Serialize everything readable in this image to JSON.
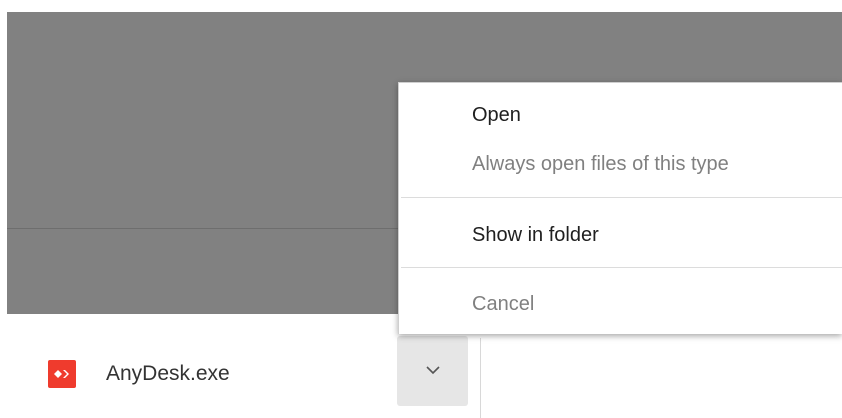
{
  "context_menu": {
    "items": [
      {
        "label": "Open",
        "enabled": true
      },
      {
        "label": "Always open files of this type",
        "enabled": false
      },
      {
        "label": "Show in folder",
        "enabled": true
      },
      {
        "label": "Cancel",
        "enabled": false
      }
    ]
  },
  "download_shelf": {
    "file_name": "AnyDesk.exe",
    "file_icon": "anydesk-icon",
    "menu_button_icon": "chevron-down-icon"
  },
  "colors": {
    "dim_overlay": "#818181",
    "file_icon_red": "#ef3b2d",
    "menu_background": "#ffffff",
    "disabled_text": "#808080"
  }
}
